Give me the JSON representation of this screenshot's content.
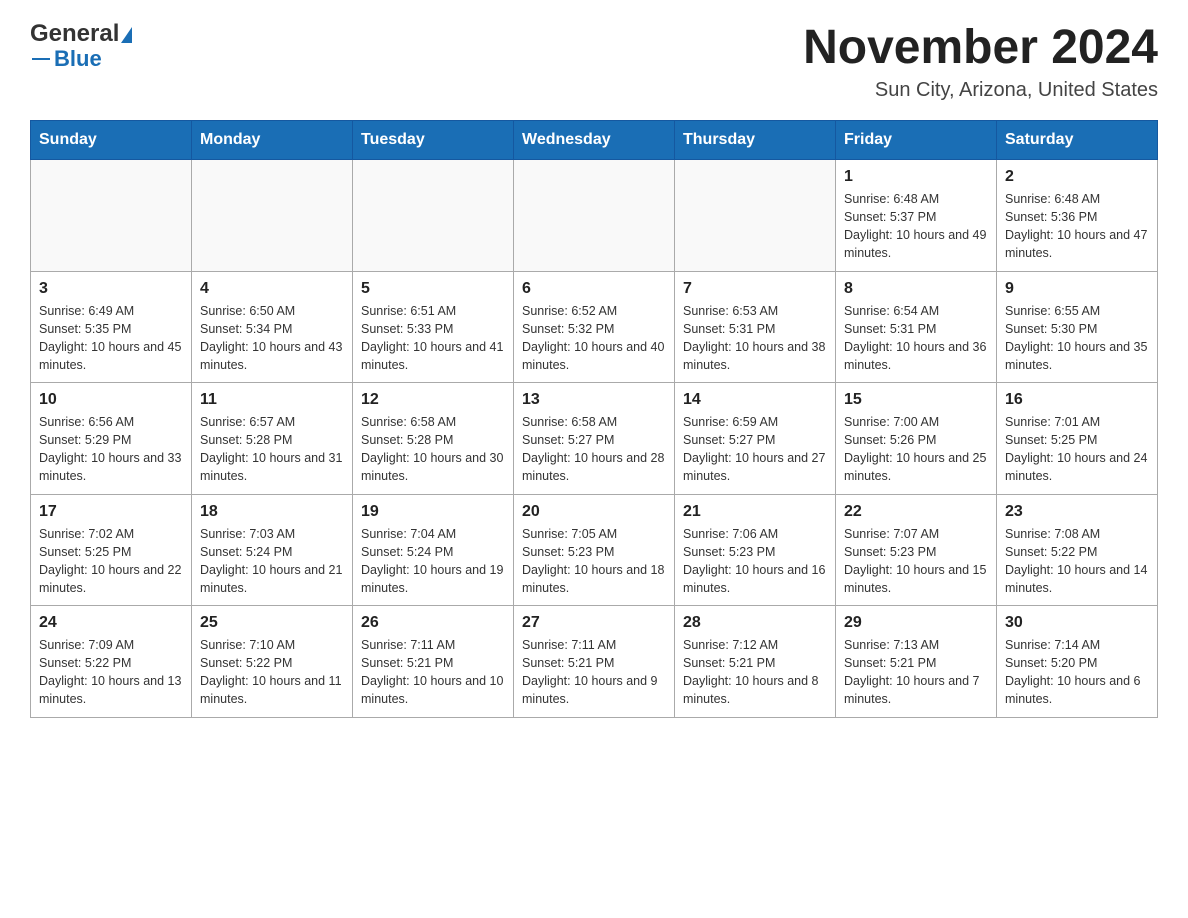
{
  "logo": {
    "general": "General",
    "blue": "Blue"
  },
  "title": "November 2024",
  "subtitle": "Sun City, Arizona, United States",
  "headers": [
    "Sunday",
    "Monday",
    "Tuesday",
    "Wednesday",
    "Thursday",
    "Friday",
    "Saturday"
  ],
  "weeks": [
    [
      {
        "day": "",
        "info": ""
      },
      {
        "day": "",
        "info": ""
      },
      {
        "day": "",
        "info": ""
      },
      {
        "day": "",
        "info": ""
      },
      {
        "day": "",
        "info": ""
      },
      {
        "day": "1",
        "info": "Sunrise: 6:48 AM\nSunset: 5:37 PM\nDaylight: 10 hours and 49 minutes."
      },
      {
        "day": "2",
        "info": "Sunrise: 6:48 AM\nSunset: 5:36 PM\nDaylight: 10 hours and 47 minutes."
      }
    ],
    [
      {
        "day": "3",
        "info": "Sunrise: 6:49 AM\nSunset: 5:35 PM\nDaylight: 10 hours and 45 minutes."
      },
      {
        "day": "4",
        "info": "Sunrise: 6:50 AM\nSunset: 5:34 PM\nDaylight: 10 hours and 43 minutes."
      },
      {
        "day": "5",
        "info": "Sunrise: 6:51 AM\nSunset: 5:33 PM\nDaylight: 10 hours and 41 minutes."
      },
      {
        "day": "6",
        "info": "Sunrise: 6:52 AM\nSunset: 5:32 PM\nDaylight: 10 hours and 40 minutes."
      },
      {
        "day": "7",
        "info": "Sunrise: 6:53 AM\nSunset: 5:31 PM\nDaylight: 10 hours and 38 minutes."
      },
      {
        "day": "8",
        "info": "Sunrise: 6:54 AM\nSunset: 5:31 PM\nDaylight: 10 hours and 36 minutes."
      },
      {
        "day": "9",
        "info": "Sunrise: 6:55 AM\nSunset: 5:30 PM\nDaylight: 10 hours and 35 minutes."
      }
    ],
    [
      {
        "day": "10",
        "info": "Sunrise: 6:56 AM\nSunset: 5:29 PM\nDaylight: 10 hours and 33 minutes."
      },
      {
        "day": "11",
        "info": "Sunrise: 6:57 AM\nSunset: 5:28 PM\nDaylight: 10 hours and 31 minutes."
      },
      {
        "day": "12",
        "info": "Sunrise: 6:58 AM\nSunset: 5:28 PM\nDaylight: 10 hours and 30 minutes."
      },
      {
        "day": "13",
        "info": "Sunrise: 6:58 AM\nSunset: 5:27 PM\nDaylight: 10 hours and 28 minutes."
      },
      {
        "day": "14",
        "info": "Sunrise: 6:59 AM\nSunset: 5:27 PM\nDaylight: 10 hours and 27 minutes."
      },
      {
        "day": "15",
        "info": "Sunrise: 7:00 AM\nSunset: 5:26 PM\nDaylight: 10 hours and 25 minutes."
      },
      {
        "day": "16",
        "info": "Sunrise: 7:01 AM\nSunset: 5:25 PM\nDaylight: 10 hours and 24 minutes."
      }
    ],
    [
      {
        "day": "17",
        "info": "Sunrise: 7:02 AM\nSunset: 5:25 PM\nDaylight: 10 hours and 22 minutes."
      },
      {
        "day": "18",
        "info": "Sunrise: 7:03 AM\nSunset: 5:24 PM\nDaylight: 10 hours and 21 minutes."
      },
      {
        "day": "19",
        "info": "Sunrise: 7:04 AM\nSunset: 5:24 PM\nDaylight: 10 hours and 19 minutes."
      },
      {
        "day": "20",
        "info": "Sunrise: 7:05 AM\nSunset: 5:23 PM\nDaylight: 10 hours and 18 minutes."
      },
      {
        "day": "21",
        "info": "Sunrise: 7:06 AM\nSunset: 5:23 PM\nDaylight: 10 hours and 16 minutes."
      },
      {
        "day": "22",
        "info": "Sunrise: 7:07 AM\nSunset: 5:23 PM\nDaylight: 10 hours and 15 minutes."
      },
      {
        "day": "23",
        "info": "Sunrise: 7:08 AM\nSunset: 5:22 PM\nDaylight: 10 hours and 14 minutes."
      }
    ],
    [
      {
        "day": "24",
        "info": "Sunrise: 7:09 AM\nSunset: 5:22 PM\nDaylight: 10 hours and 13 minutes."
      },
      {
        "day": "25",
        "info": "Sunrise: 7:10 AM\nSunset: 5:22 PM\nDaylight: 10 hours and 11 minutes."
      },
      {
        "day": "26",
        "info": "Sunrise: 7:11 AM\nSunset: 5:21 PM\nDaylight: 10 hours and 10 minutes."
      },
      {
        "day": "27",
        "info": "Sunrise: 7:11 AM\nSunset: 5:21 PM\nDaylight: 10 hours and 9 minutes."
      },
      {
        "day": "28",
        "info": "Sunrise: 7:12 AM\nSunset: 5:21 PM\nDaylight: 10 hours and 8 minutes."
      },
      {
        "day": "29",
        "info": "Sunrise: 7:13 AM\nSunset: 5:21 PM\nDaylight: 10 hours and 7 minutes."
      },
      {
        "day": "30",
        "info": "Sunrise: 7:14 AM\nSunset: 5:20 PM\nDaylight: 10 hours and 6 minutes."
      }
    ]
  ]
}
